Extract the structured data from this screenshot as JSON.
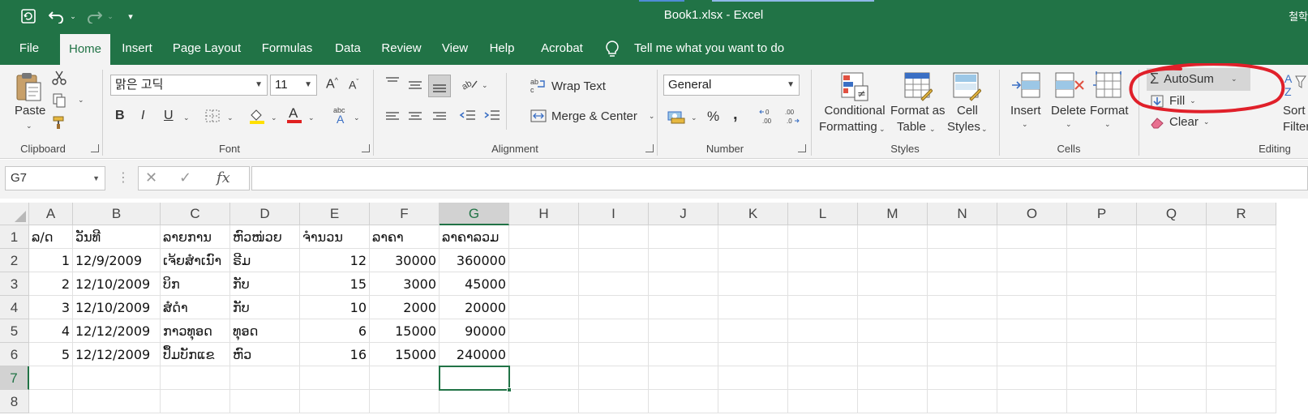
{
  "window": {
    "title": "Book1.xlsx  -  Excel",
    "user": "철학"
  },
  "qat": {
    "save_icon": "autosave-icon",
    "undo_icon": "undo-icon",
    "redo_icon": "redo-icon",
    "customize_icon": "customize-qat-icon"
  },
  "tabs": [
    {
      "label": "File",
      "active": false
    },
    {
      "label": "Home",
      "active": true
    },
    {
      "label": "Insert",
      "active": false
    },
    {
      "label": "Page Layout",
      "active": false
    },
    {
      "label": "Formulas",
      "active": false
    },
    {
      "label": "Data",
      "active": false
    },
    {
      "label": "Review",
      "active": false
    },
    {
      "label": "View",
      "active": false
    },
    {
      "label": "Help",
      "active": false
    },
    {
      "label": "Acrobat",
      "active": false
    }
  ],
  "tell_me": "Tell me what you want to do",
  "ribbon": {
    "clipboard": {
      "label": "Clipboard",
      "paste": "Paste"
    },
    "font": {
      "label": "Font",
      "name": "맑은 고딕",
      "size": "11",
      "bold": "B",
      "italic": "I",
      "underline": "U"
    },
    "alignment": {
      "label": "Alignment",
      "wrap_text": "Wrap Text",
      "merge_center": "Merge & Center"
    },
    "number": {
      "label": "Number",
      "format": "General",
      "percent": "%",
      "comma": ","
    },
    "styles": {
      "label": "Styles",
      "conditional_1": "Conditional",
      "conditional_2": "Formatting",
      "format_table_1": "Format as",
      "format_table_2": "Table",
      "cell_styles_1": "Cell",
      "cell_styles_2": "Styles"
    },
    "cells": {
      "label": "Cells",
      "insert": "Insert",
      "delete": "Delete",
      "format": "Format"
    },
    "editing": {
      "label": "Editing",
      "autosum": "AutoSum",
      "fill": "Fill",
      "clear": "Clear",
      "sort_1": "Sort",
      "sort_2": "Filter"
    }
  },
  "formula_bar": {
    "name_box": "G7",
    "fx": "fx",
    "formula": ""
  },
  "columns": [
    "A",
    "B",
    "C",
    "D",
    "E",
    "F",
    "G",
    "H",
    "I",
    "J",
    "K",
    "L",
    "M",
    "N",
    "O",
    "P",
    "Q",
    "R"
  ],
  "rows": [
    "1",
    "2",
    "3",
    "4",
    "5",
    "6",
    "7",
    "8"
  ],
  "selected": {
    "column": "G",
    "row": "7"
  },
  "sheet": {
    "headers": [
      "ລ/ດ",
      "ວັນທີ",
      "ລາຍການ",
      "ຫົວໜ່ວຍ",
      "ຈຳນວນ",
      "ລາຄາ",
      "ລາຄາລວມ"
    ],
    "rows": [
      [
        "1",
        "12/9/2009",
        "ເຈ້ຍສຳເນົາ",
        "ຣີມ",
        "12",
        "30000",
        "360000"
      ],
      [
        "2",
        "12/10/2009",
        "ບິກ",
        "ກັບ",
        "15",
        "3000",
        "45000"
      ],
      [
        "3",
        "12/10/2009",
        "ສໍດຳ",
        "ກັບ",
        "10",
        "2000",
        "20000"
      ],
      [
        "4",
        "12/12/2009",
        "ກາວທຸອດ",
        "ທຸອດ",
        "6",
        "15000",
        "90000"
      ],
      [
        "5",
        "12/12/2009",
        "ປຶ້ມບັກແຂ",
        "ຫົວ",
        "16",
        "15000",
        "240000"
      ]
    ]
  },
  "colors": {
    "excel_green": "#217346",
    "annotation_red": "#e0202a"
  }
}
